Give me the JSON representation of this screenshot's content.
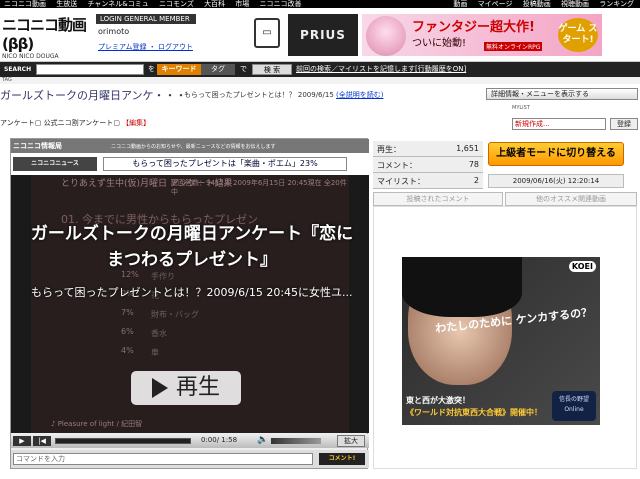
{
  "topnav": {
    "left_items": [
      "ニコニコ動画",
      "生放送",
      "チャンネル&コミュ",
      "ニコモンズ",
      "大百科",
      "市場",
      "ニコニコ改善"
    ],
    "right_items": [
      "動画",
      "マイページ",
      "投稿動画",
      "視聴動画",
      "ランキング"
    ]
  },
  "header": {
    "logo_text": "ニコニコ動画(ββ)",
    "logo_sub": "NICO NICO DOUGA",
    "login_badge": "LOGIN GENERAL MEMBER",
    "username": "orimoto",
    "premium_link": "プレミアム登録",
    "logout_link": "ログアウト"
  },
  "ads": {
    "prius": "PRIUS",
    "banner_title": "ファンタジー超大作!",
    "banner_sub": "ついに始動!",
    "banner_tag": "無料オンラインRPG",
    "banner_start": "ゲーム スタート!"
  },
  "search": {
    "label": "SEARCH",
    "placeholder": "",
    "wo": "を",
    "keyword_tab": "キーワード",
    "tag_tab": "タグ",
    "de": "で",
    "button": "検 索",
    "history": "前回の検索／マイリストを記憶します[行動履歴をON]"
  },
  "tagbar": {
    "label": "TAG"
  },
  "video": {
    "title": "ガールズトークの月曜日アンケ・・・",
    "subtitle": "もらって困ったプレゼントとは！？ 2009/6/15",
    "full_text_link": "(全説明を読む)",
    "detail_menu": "詳細情報・メニューを表示する",
    "tag1": "アンケート",
    "tag2": "公式ニコ割アンケート",
    "edit": "【編集】"
  },
  "mylist": {
    "label": "MYLIST",
    "selected": "新規作成...",
    "register": "登録"
  },
  "player": {
    "info_logo": "ニコニコ情報局",
    "info_text": "ニコニコ動画からのお知らせや、最新ニュースなどの情報をお伝えします",
    "news_label": "ニコニコニュース",
    "ticker": "もらって困ったプレゼントは「楽曲・ポエム」23%",
    "bg_heading": "とりあえず生中(仮)月曜日 アンケート結果",
    "bg_heading2": "総回答数：9412人 2009年6月15日 20:45現在 全20件中",
    "bg_question": "01. 今までに男性からもらったプレゼン",
    "bg_answers": [
      "手作り",
      "花",
      "財布・バッグ",
      "香水",
      "車"
    ],
    "bg_pcts": [
      "12%",
      "9%",
      "7%",
      "6%",
      "4%"
    ],
    "bg_song": "♪ Pleasure of light / 紀田智",
    "overlay_title": "ガールズトークの月曜日アンケート『恋にまつわるプレゼント』",
    "overlay_sub": "もらって困ったプレゼントとは！？2009/6/15 20:45に女性ユ...",
    "play_label": "再生",
    "time": "0:00/ 1:58",
    "zoom": "拡大",
    "comment_placeholder": "コマンドを入力",
    "comment_button": "コメント!"
  },
  "stats": {
    "views_label": "再生：",
    "views": "1,651",
    "comments_label": "コメント：",
    "comments": "78",
    "mylists_label": "マイリスト：",
    "mylists": "2"
  },
  "side": {
    "upper_mode": "上級者モードに切り替える",
    "date": "2009/06/16(火) 12:20:14",
    "tab_comments": "投稿されたコメント",
    "tab_related": "他のオススメ関連動画"
  },
  "ad_box": {
    "koei": "KOEI",
    "copy": "わたしのために ケンカするの？",
    "foot1": "東と西が大激突！",
    "foot2": "《ワールド対抗東西大合戦》開催中！",
    "brand": "信長の野望 Online"
  }
}
